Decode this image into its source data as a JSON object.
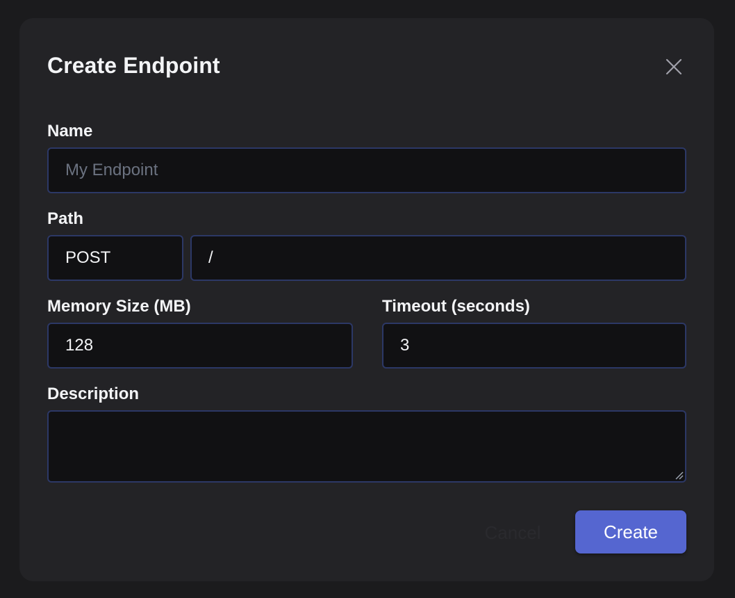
{
  "dialog": {
    "title": "Create Endpoint",
    "close_icon": "close-icon"
  },
  "form": {
    "name": {
      "label": "Name",
      "value": "",
      "placeholder": "My Endpoint"
    },
    "path": {
      "label": "Path",
      "method": "POST",
      "route": "/"
    },
    "memory": {
      "label": "Memory Size (MB)",
      "value": "128"
    },
    "timeout": {
      "label": "Timeout (seconds)",
      "value": "3"
    },
    "description": {
      "label": "Description",
      "value": ""
    }
  },
  "actions": {
    "cancel_label": "Cancel",
    "create_label": "Create"
  },
  "colors": {
    "accent": "#5566d0",
    "field_border": "#2c3866",
    "panel": "#232326"
  }
}
